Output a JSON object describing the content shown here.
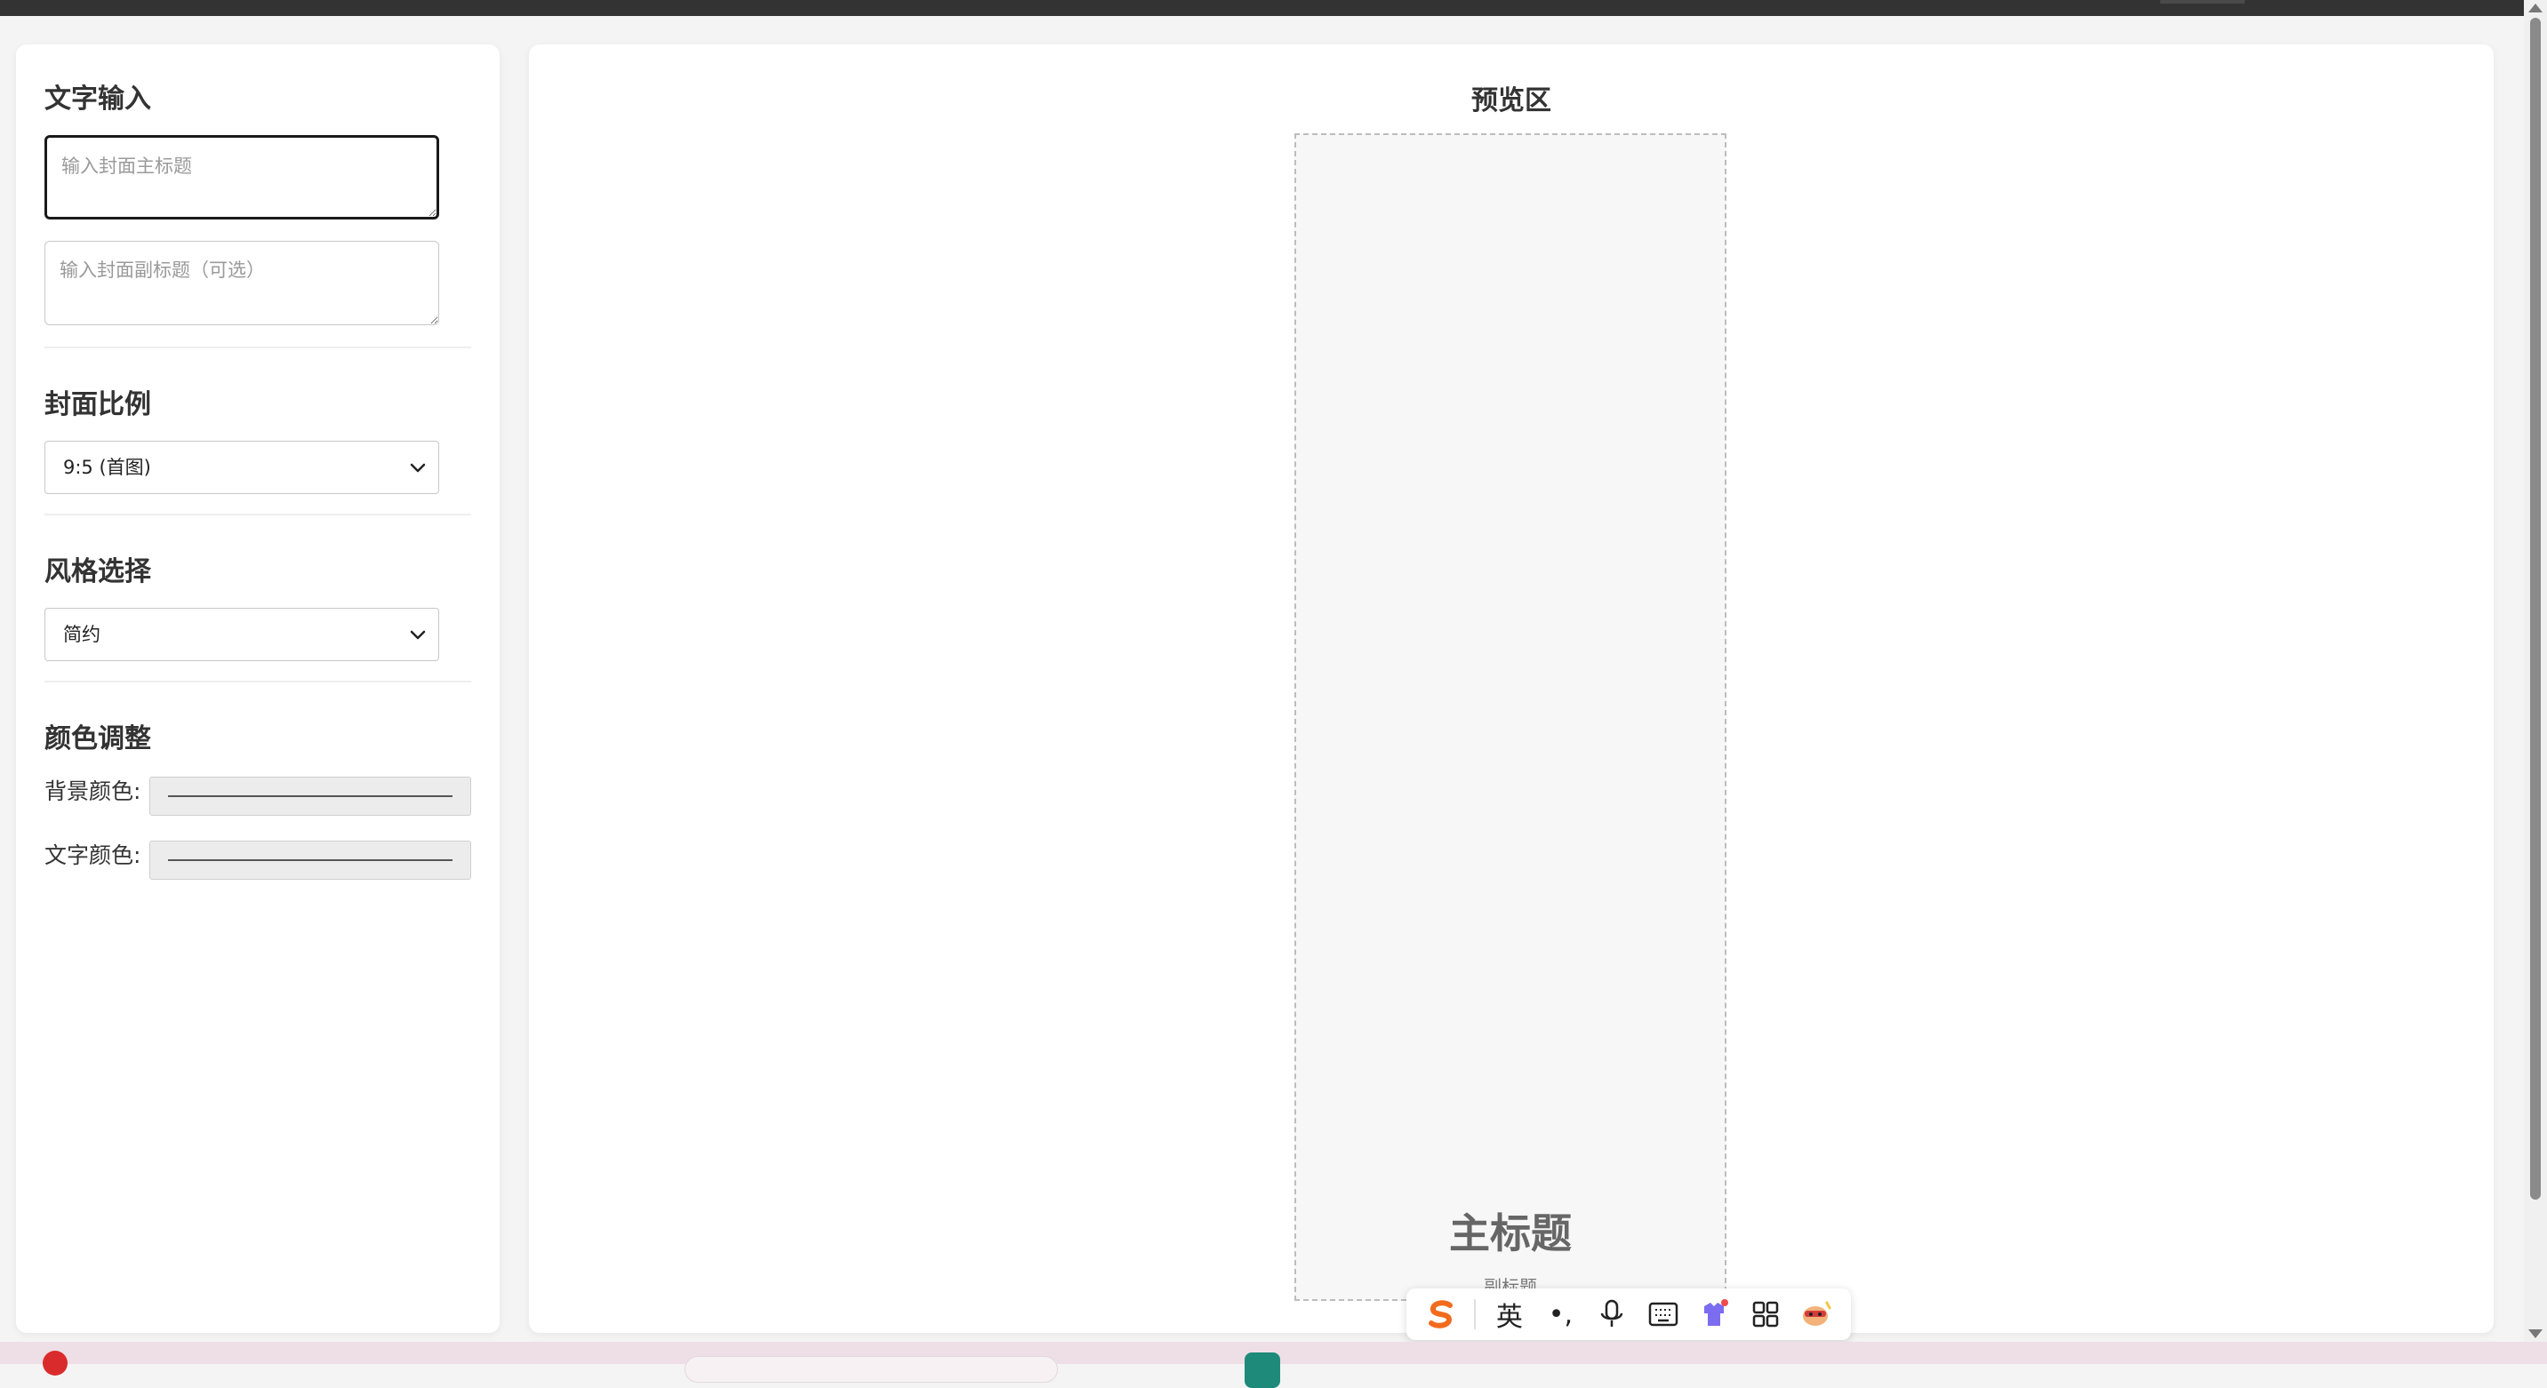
{
  "sidebar": {
    "text_section": {
      "title": "文字输入",
      "main_title_placeholder": "输入封面主标题",
      "sub_title_placeholder": "输入封面副标题（可选）"
    },
    "ratio_section": {
      "title": "封面比例",
      "selected": "9:5 (首图)"
    },
    "style_section": {
      "title": "风格选择",
      "selected": "简约"
    },
    "color_section": {
      "title": "颜色调整",
      "bg_label": "背景颜色:",
      "text_label": "文字颜色:"
    }
  },
  "preview": {
    "title": "预览区",
    "main_title": "主标题",
    "sub_title": "副标题"
  },
  "ime_toolbar": {
    "logo": "S",
    "mode": "英",
    "punct": "•,",
    "icons": [
      "sogou-logo-icon",
      "mode-english",
      "punctuation-icon",
      "microphone-icon",
      "keyboard-icon",
      "skin-icon",
      "toolbox-icon",
      "mascot-icon"
    ]
  },
  "colors": {
    "accent_text": "#333333",
    "preview_bg": "#f7f7f7",
    "sogou_orange": "#f26b1d"
  }
}
